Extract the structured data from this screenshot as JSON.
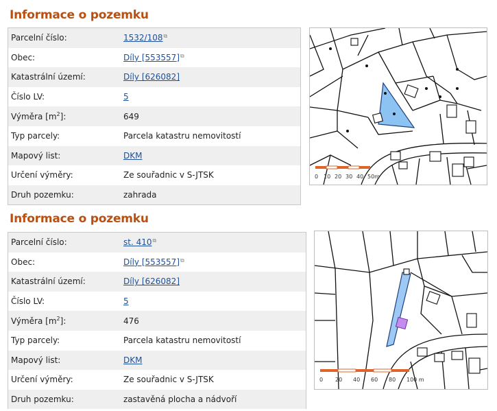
{
  "sections": [
    {
      "title": "Informace o pozemku",
      "rows": [
        {
          "label": "Parcelní číslo:",
          "value": "1532/108",
          "link": true,
          "external": true
        },
        {
          "label": "Obec:",
          "value": "Díly [553557]",
          "link": true,
          "external": true
        },
        {
          "label": "Katastrální území:",
          "value": "Díly [626082]",
          "link": true,
          "external": false
        },
        {
          "label": "Číslo LV:",
          "value": "5",
          "link": true,
          "external": false
        },
        {
          "label": "Výměra [m",
          "label_sup": "2",
          "label_end": "]:",
          "value": "649",
          "link": false
        },
        {
          "label": "Typ parcely:",
          "value": "Parcela katastru nemovitostí",
          "link": false
        },
        {
          "label": "Mapový list:",
          "value": "DKM",
          "link": true,
          "external": false
        },
        {
          "label": "Určení výměry:",
          "value": "Ze souřadnic v S-JTSK",
          "link": false
        },
        {
          "label": "Druh pozemku:",
          "value": "zahrada",
          "link": false
        }
      ],
      "map": {
        "scale_labels": [
          "0",
          "10",
          "20",
          "30",
          "40",
          "50m"
        ],
        "highlight_color": "#8cc3f3"
      }
    },
    {
      "title": "Informace o pozemku",
      "rows": [
        {
          "label": "Parcelní číslo:",
          "value": "st. 410",
          "link": true,
          "external": true
        },
        {
          "label": "Obec:",
          "value": "Díly [553557]",
          "link": true,
          "external": true
        },
        {
          "label": "Katastrální území:",
          "value": "Díly [626082]",
          "link": true,
          "external": false
        },
        {
          "label": "Číslo LV:",
          "value": "5",
          "link": true,
          "external": false
        },
        {
          "label": "Výměra [m",
          "label_sup": "2",
          "label_end": "]:",
          "value": "476",
          "link": false
        },
        {
          "label": "Typ parcely:",
          "value": "Parcela katastru nemovitostí",
          "link": false
        },
        {
          "label": "Mapový list:",
          "value": "DKM",
          "link": true,
          "external": false
        },
        {
          "label": "Určení výměry:",
          "value": "Ze souřadnic v S-JTSK",
          "link": false
        },
        {
          "label": "Druh pozemku:",
          "value": "zastavěná plocha a nádvoří",
          "link": false
        }
      ],
      "map": {
        "scale_labels": [
          "0",
          "20",
          "40",
          "60",
          "80",
          "100 m"
        ],
        "highlight_color": "#9ec9f5",
        "building_color": "#c58cf0"
      }
    }
  ]
}
